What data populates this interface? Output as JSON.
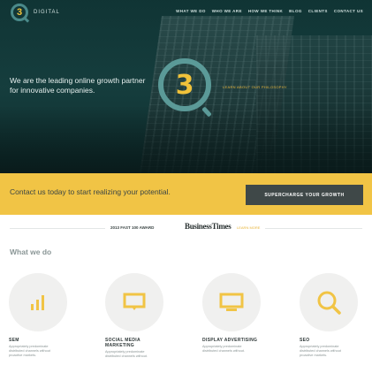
{
  "brand": {
    "mark": "3",
    "name": "DIGITAL"
  },
  "nav": [
    "WHAT WE DO",
    "WHO WE ARE",
    "HOW WE THINK",
    "BLOG",
    "CLIENTS",
    "CONTACT US"
  ],
  "hero": {
    "tagline": "We are the leading online growth partner for innovative companies.",
    "big_mark": "3",
    "philosophy_link": "LEARN ABOUT OUR PHILOSOPHY"
  },
  "cta": {
    "text": "Contact us today to start realizing your potential.",
    "button": "SUPERCHARGE YOUR GROWTH"
  },
  "award": {
    "text": "2013 FAST 100 AWARD",
    "logo": "BusinessTimes",
    "learn": "LEARN MORE"
  },
  "what_we_do": {
    "heading": "What we do",
    "services": [
      {
        "title": "SEM",
        "desc": "Appropriately predominate distributed channels without proactive markets.",
        "icon": "bar-chart-icon"
      },
      {
        "title": "SOCIAL MEDIA MARKETING",
        "desc": "Appropriately predominate distributed channels without.",
        "icon": "speech-bubble-icon"
      },
      {
        "title": "DISPLAY ADVERTISING",
        "desc": "Appropriately predominate distributed channels without.",
        "icon": "monitor-icon"
      },
      {
        "title": "SEO",
        "desc": "Appropriately predominate distributed channels without proactive markets.",
        "icon": "magnifier-icon"
      }
    ]
  },
  "colors": {
    "accent": "#f1c445",
    "dark": "#3f4848",
    "teal": "#5b9a98",
    "hero_bg": "#123a3a"
  }
}
